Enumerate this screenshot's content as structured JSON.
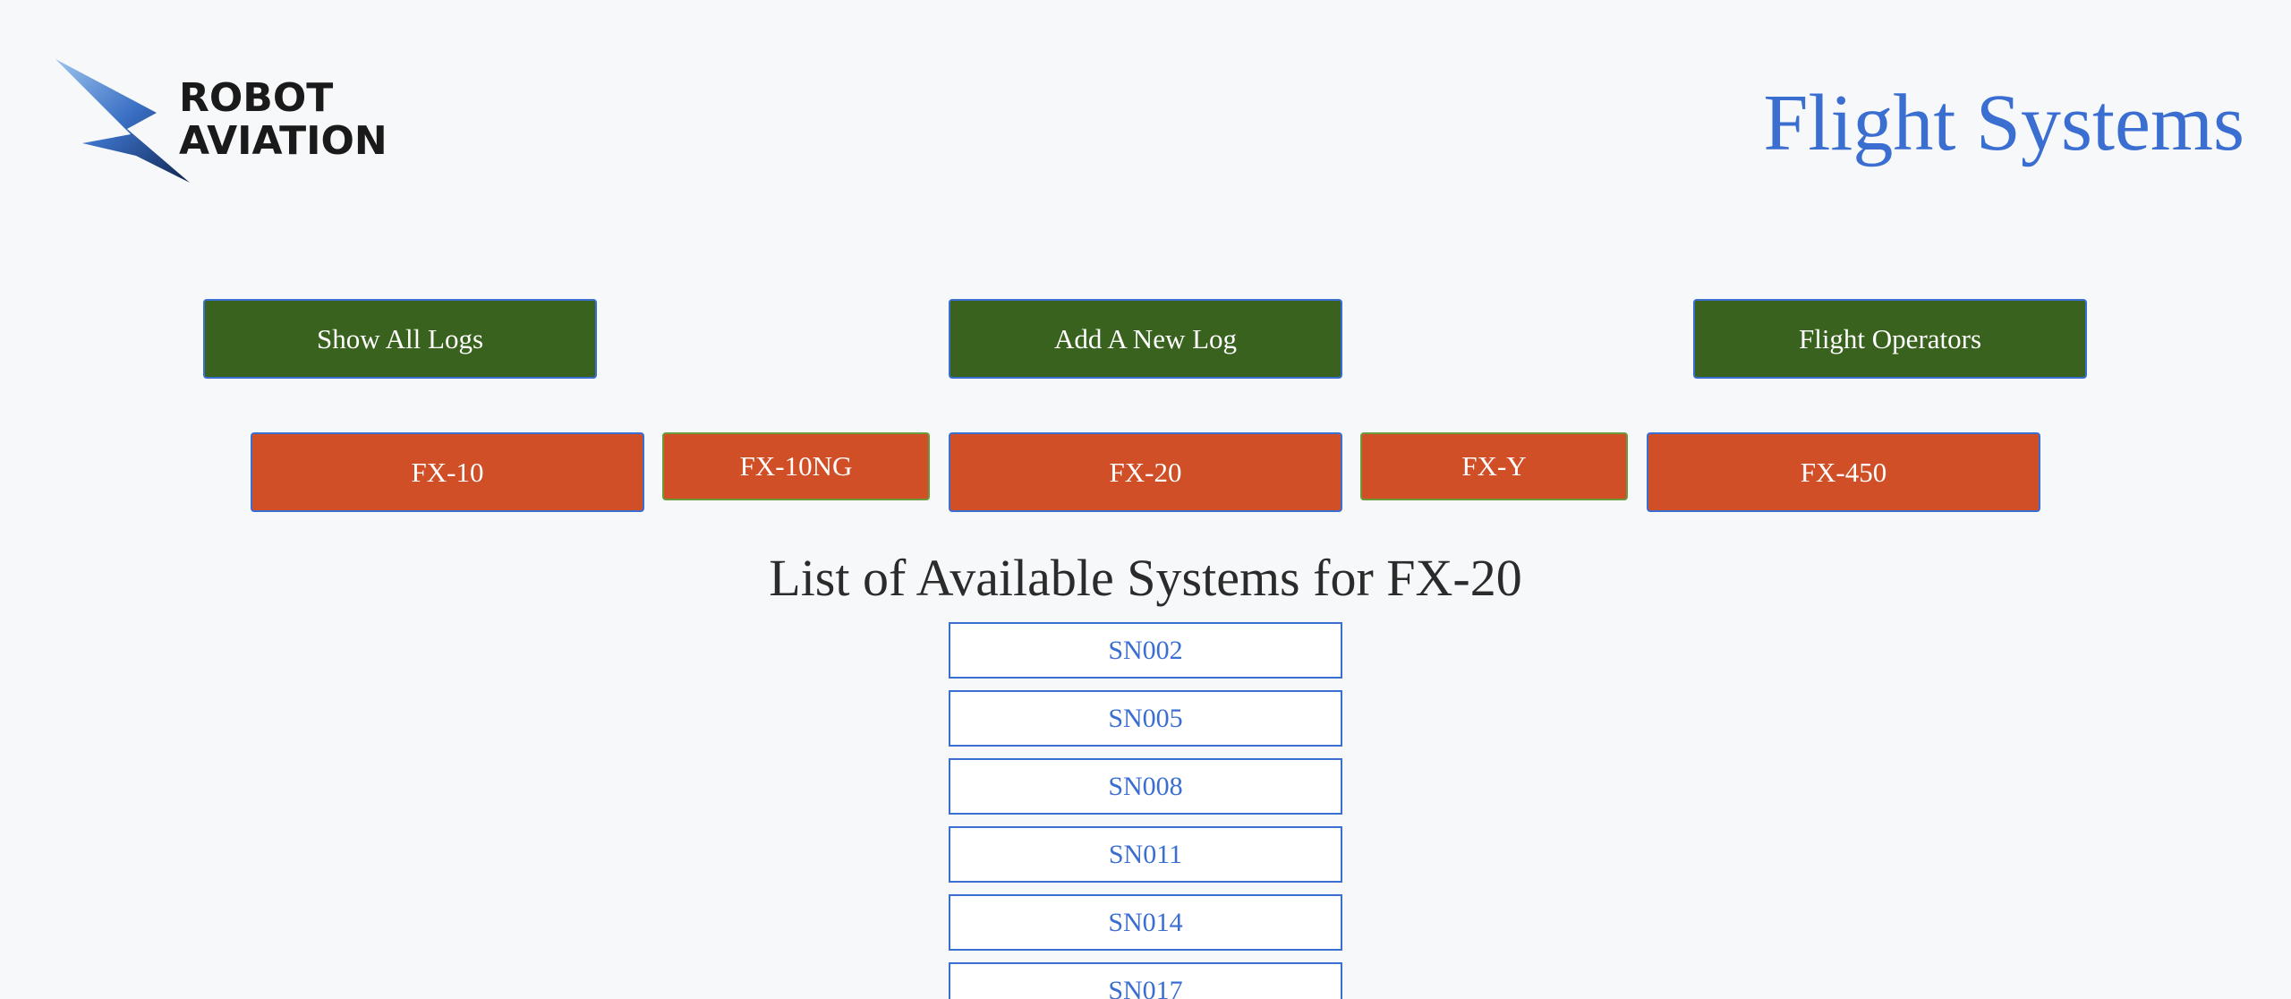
{
  "header": {
    "logo_line1": "ROBOT",
    "logo_line2": "AVIATION",
    "title": "Flight Systems"
  },
  "nav": {
    "show_all_logs": "Show All Logs",
    "add_new_log": "Add A New Log",
    "flight_operators": "Flight Operators"
  },
  "models": {
    "fx10": "FX-10",
    "fx10ng": "FX-10NG",
    "fx20": "FX-20",
    "fxy": "FX-Y",
    "fx450": "FX-450"
  },
  "section": {
    "heading": "List of Available Systems for FX-20"
  },
  "systems": [
    "SN002",
    "SN005",
    "SN008",
    "SN011",
    "SN014",
    "SN017"
  ],
  "colors": {
    "accent_blue": "#3b6ed1",
    "nav_green": "#38621d",
    "model_orange": "#d04f27",
    "background": "#f6f8fa"
  }
}
